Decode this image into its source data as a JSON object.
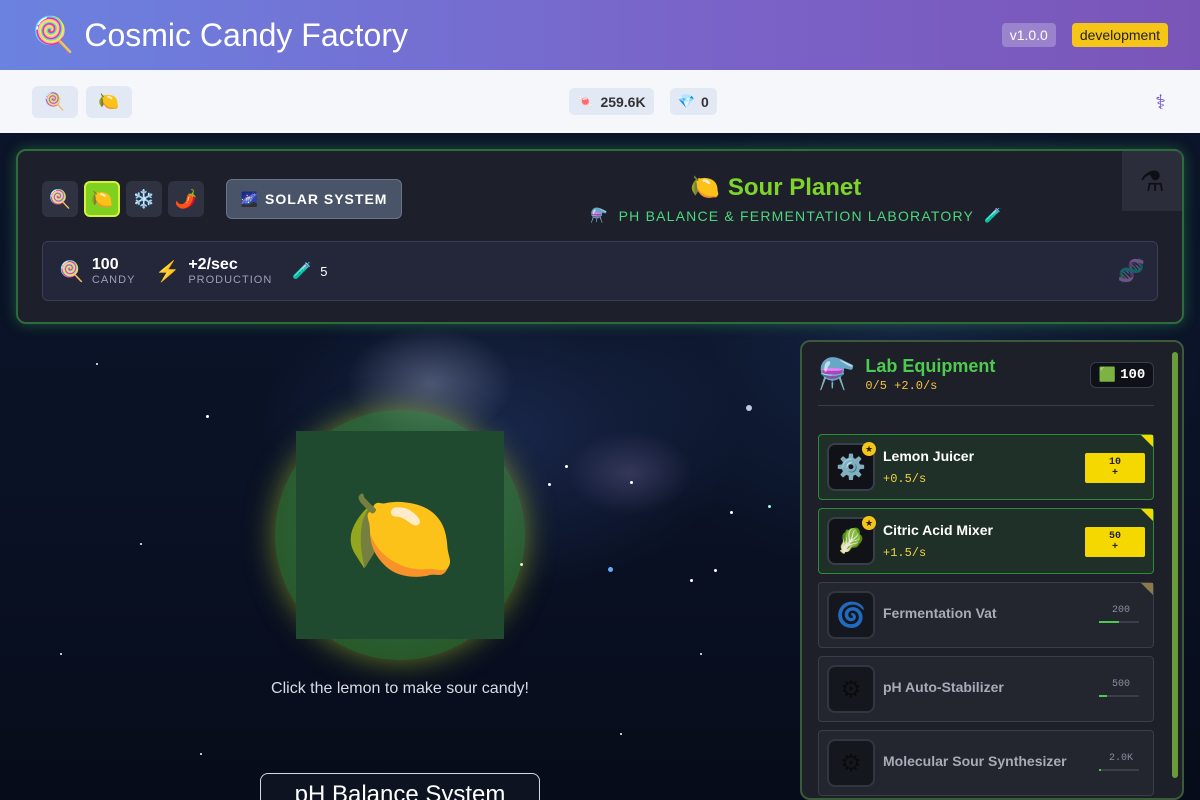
{
  "header": {
    "logo_icon": "🍭",
    "title": "Cosmic Candy Factory",
    "version": "v1.0.0",
    "env": "development"
  },
  "toolbar": {
    "buttons": [
      {
        "icon": "🍭"
      },
      {
        "icon": "🍋"
      }
    ],
    "resources": [
      {
        "icon": "🍬",
        "value": "259.6K"
      },
      {
        "icon": "💎",
        "value": "0"
      }
    ],
    "right_icon": "⚕"
  },
  "planet": {
    "selector": [
      {
        "icon": "🍭"
      },
      {
        "icon": "🍋"
      },
      {
        "icon": "❄️"
      },
      {
        "icon": "🌶️"
      }
    ],
    "solar_label": "SOLAR SYSTEM",
    "solar_icon": "🌌",
    "title": "Sour Planet",
    "title_icon": "🍋",
    "subtitle": "PH BALANCE & FERMENTATION LABORATORY",
    "stats": {
      "candy": {
        "icon": "🍭",
        "value": "100",
        "label": "CANDY"
      },
      "production": {
        "icon": "⚡",
        "value": "+2/sec",
        "label": "PRODUCTION"
      },
      "flasks": {
        "icon": "🧪",
        "value": "5"
      }
    }
  },
  "clicker": {
    "icon": "🍋",
    "hint": "Click the lemon to make sour candy!",
    "section_title": "pH Balance System"
  },
  "lab": {
    "title": "Lab Equipment",
    "subtitle": "0/5 +2.0/s",
    "badge_value": "100",
    "items": [
      {
        "name": "Lemon Juicer",
        "rate": "+0.5/s",
        "buy_cost": "10",
        "buy_plus": "+",
        "icon": "⚙️",
        "owned": true
      },
      {
        "name": "Citric Acid Mixer",
        "rate": "+1.5/s",
        "buy_cost": "50",
        "buy_plus": "+",
        "icon": "🥬",
        "owned": true
      },
      {
        "name": "Fermentation Vat",
        "cost": "200",
        "progress": 0.5,
        "icon": "🌀",
        "owned": false
      },
      {
        "name": "pH Auto-Stabilizer",
        "cost": "500",
        "progress": 0.2,
        "icon": "⚙",
        "owned": false
      },
      {
        "name": "Molecular Sour Synthesizer",
        "cost": "2.0K",
        "progress": 0.05,
        "icon": "⚙",
        "owned": false
      }
    ]
  }
}
